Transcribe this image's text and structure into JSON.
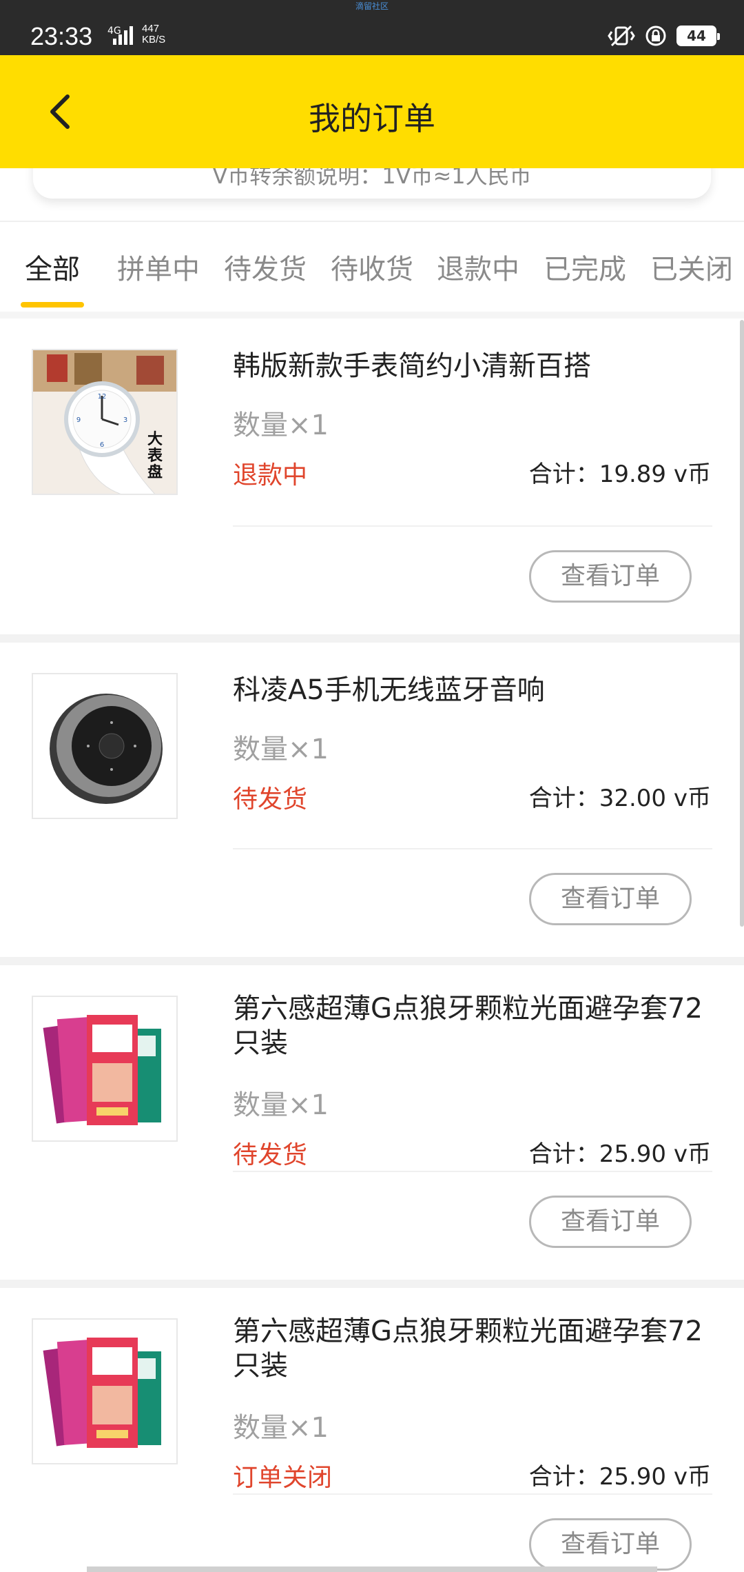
{
  "status_bar": {
    "time": "23:33",
    "network": "4G",
    "speed_value": "447",
    "speed_unit": "KB/S",
    "center_text": "滴留社区",
    "battery": "44"
  },
  "header": {
    "title": "我的订单",
    "back_icon": "chevron-left-icon"
  },
  "notice": {
    "text": "V币转余额说明：1V币≈1人民币"
  },
  "tabs": [
    {
      "label": "全部",
      "active": true
    },
    {
      "label": "拼单中",
      "active": false
    },
    {
      "label": "待发货",
      "active": false
    },
    {
      "label": "待收货",
      "active": false
    },
    {
      "label": "退款中",
      "active": false
    },
    {
      "label": "已完成",
      "active": false
    },
    {
      "label": "已关闭",
      "active": false
    }
  ],
  "colors": {
    "header": "#ffdd00",
    "tab_indicator": "#ffc400",
    "status_red": "#e0452c"
  },
  "orders": [
    {
      "name": "韩版新款手表简约小清新百搭",
      "quantity": "数量×1",
      "status": "退款中",
      "total": "合计：19.89 v币",
      "button": "查看订单",
      "image_label": "大表盘"
    },
    {
      "name": "科凌A5手机无线蓝牙音响",
      "quantity": "数量×1",
      "status": "待发货",
      "total": "合计：32.00 v币",
      "button": "查看订单"
    },
    {
      "name": "第六感超薄G点狼牙颗粒光面避孕套72只装",
      "quantity": "数量×1",
      "status": "待发货",
      "total": "合计：25.90 v币",
      "button": "查看订单"
    },
    {
      "name": "第六感超薄G点狼牙颗粒光面避孕套72只装",
      "quantity": "数量×1",
      "status": "订单关闭",
      "total": "合计：25.90 v币",
      "button": "查看订单"
    }
  ]
}
